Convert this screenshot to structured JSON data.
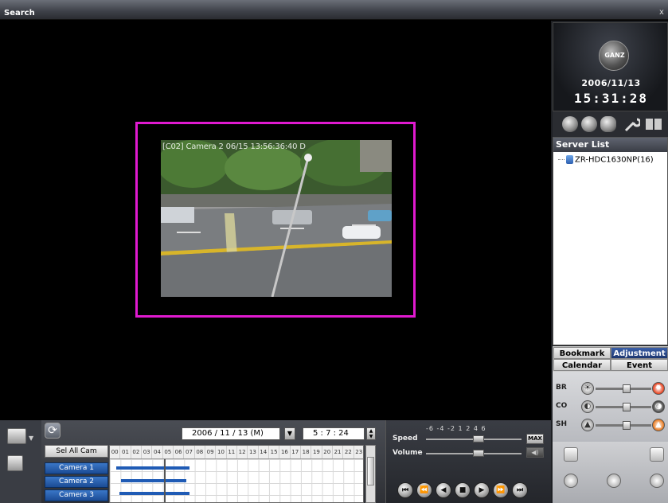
{
  "window": {
    "title": "Search",
    "close_glyph": "x"
  },
  "video": {
    "osd_text": "[C02] Camera 2 06/15 13:56:36:40 D"
  },
  "clock": {
    "logo_text": "GANZ",
    "date": "2006/11/13",
    "time": "15:31:28"
  },
  "server_list": {
    "header": "Server List",
    "items": [
      "ZR-HDC1630NP(16)"
    ]
  },
  "tabs": {
    "bookmark": "Bookmark",
    "adjustment": "Adjustment",
    "calendar": "Calendar",
    "event": "Event"
  },
  "adjustment": {
    "rows": [
      {
        "label": "BR",
        "level": 0.55,
        "color": "#e8401c"
      },
      {
        "label": "CO",
        "level": 0.55,
        "color": "#444444"
      },
      {
        "label": "SH",
        "level": 0.55,
        "color": "#e8781c"
      }
    ]
  },
  "search": {
    "date": "2006  / 11 / 13  (M)",
    "time": "5  :  7  :  24",
    "sel_all_cam": "Sel All Cam",
    "hours": [
      "00",
      "01",
      "02",
      "03",
      "04",
      "05",
      "06",
      "07",
      "08",
      "09",
      "10",
      "11",
      "12",
      "13",
      "14",
      "15",
      "16",
      "17",
      "18",
      "19",
      "20",
      "21",
      "22",
      "23"
    ],
    "cameras": [
      "Camera 1",
      "Camera 2",
      "Camera 3"
    ]
  },
  "playback": {
    "speed_scale": "-6 -4 -2 1 2 4 6",
    "speed_label": "Speed",
    "volume_label": "Volume",
    "max_label": "MAX",
    "speed_level": 0.55,
    "volume_level": 0.55,
    "controls": [
      "first-frame",
      "prev-frame",
      "reverse-play",
      "stop",
      "play",
      "next-frame",
      "last-frame"
    ]
  },
  "icons": [
    "logo-globe-icon",
    "search-mode-icon",
    "globe-icon",
    "storage-icon",
    "wrench-icon",
    "monitor-icon",
    "layout-icon",
    "printer-icon",
    "refresh-icon",
    "zoom-in-icon",
    "zoom-out-icon",
    "hand-icon"
  ]
}
